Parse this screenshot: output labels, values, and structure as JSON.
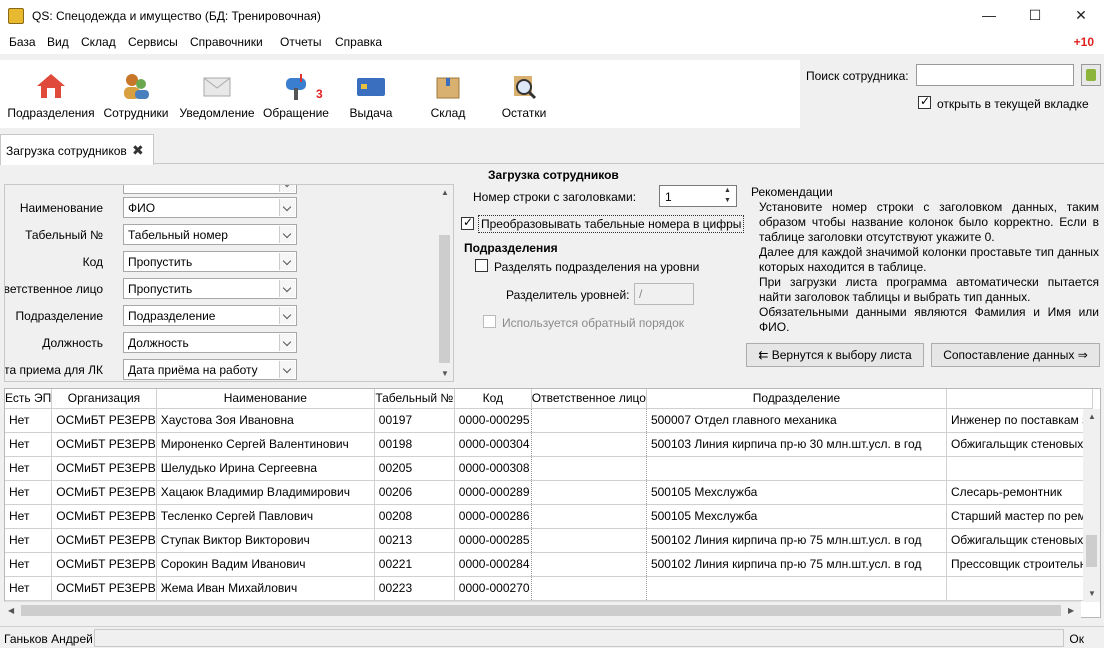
{
  "window": {
    "title": "QS: Спецодежда и имущество (БД: Тренировочная)"
  },
  "menu": {
    "items": [
      "База",
      "Вид",
      "Склад",
      "Сервисы",
      "Справочники",
      "Отчеты",
      "Справка"
    ],
    "badge": "+10"
  },
  "toolbar": {
    "buttons": [
      {
        "label": "Подразделения",
        "icon": "house-icon"
      },
      {
        "label": "Сотрудники",
        "icon": "people-icon"
      },
      {
        "label": "Уведомление",
        "icon": "envelope-icon"
      },
      {
        "label": "Обращение",
        "icon": "mailbox-icon",
        "badge": "3"
      },
      {
        "label": "Выдача",
        "icon": "card-icon"
      },
      {
        "label": "Склад",
        "icon": "box-icon"
      },
      {
        "label": "Остатки",
        "icon": "magnifier-icon"
      }
    ]
  },
  "search": {
    "label": "Поиск сотрудника:",
    "value": "",
    "open_in_tab_label": "открыть в текущей вкладке",
    "open_in_tab_checked": true
  },
  "tab": {
    "label": "Загрузка сотрудников"
  },
  "mapping": {
    "fields": [
      {
        "label": "Наименование",
        "value": "ФИО"
      },
      {
        "label": "Табельный №",
        "value": "Табельный номер"
      },
      {
        "label": "Код",
        "value": "Пропустить"
      },
      {
        "label": "Ответственное лицо",
        "value": "Пропустить"
      },
      {
        "label": "Подразделение",
        "value": "Подразделение"
      },
      {
        "label": "Должность",
        "value": "Должность"
      },
      {
        "label": "Дата приема для ЛК",
        "value": "Дата приёма на работу"
      }
    ]
  },
  "load_form": {
    "title": "Загрузка сотрудников",
    "header_row_label": "Номер строки с заголовками:",
    "header_row_value": "1",
    "convert_label": "Преобразовывать табельные номера в цифры",
    "convert_checked": true,
    "departments_title": "Подразделения",
    "split_levels_label": "Разделять подразделения на уровни",
    "split_levels_checked": false,
    "separator_label": "Разделитель уровней:",
    "separator_value": "/",
    "reverse_order_label": "Используется обратный порядок",
    "reverse_order_checked": false
  },
  "recommendations": {
    "title": "Рекомендации",
    "paragraphs": [
      "Установите номер строки с заголовком данных, таким образом чтобы название колонок было корректно. Если в таблице заголовки отсутствуют укажите 0.",
      "Далее для каждой значимой колонки проставьте тип данных которых находится в таблице.",
      "При загрузки листа программа автоматически пытается найти заголовок таблицы и выбрать тип данных.",
      "Обязательными данными являются Фамилия и Имя или ФИО."
    ]
  },
  "buttons": {
    "back": "⇇ Вернутся к выбору листа",
    "match": "Сопоставление данных ⇒"
  },
  "grid": {
    "columns": [
      "Есть ЭП",
      "Организация",
      "Наименование",
      "Табельный №",
      "Код",
      "Ответственное лицо",
      "Подразделение",
      ""
    ],
    "rows": [
      [
        "Нет",
        "ОСМиБТ РЕЗЕРВ",
        "Хаустова Зоя Ивановна",
        "00197",
        "0000-000295",
        "",
        "500007 Отдел главного механика",
        "Инженер по поставкам з"
      ],
      [
        "Нет",
        "ОСМиБТ РЕЗЕРВ",
        "Мироненко Сергей Валентинович",
        "00198",
        "0000-000304",
        "",
        "500103 Линия кирпича пр-ю 30 млн.шт.усл. в год",
        "Обжигальщик стеновых"
      ],
      [
        "Нет",
        "ОСМиБТ РЕЗЕРВ",
        "Шелудько Ирина Сергеевна",
        "00205",
        "0000-000308",
        "",
        "",
        ""
      ],
      [
        "Нет",
        "ОСМиБТ РЕЗЕРВ",
        "Хацаюк Владимир Владимирович",
        "00206",
        "0000-000289",
        "",
        "500105 Мехслужба",
        "Слесарь-ремонтник"
      ],
      [
        "Нет",
        "ОСМиБТ РЕЗЕРВ",
        "Тесленко Сергей Павлович",
        "00208",
        "0000-000286",
        "",
        "500105 Мехслужба",
        "Старший мастер по ремо"
      ],
      [
        "Нет",
        "ОСМиБТ РЕЗЕРВ",
        "Ступак Виктор Викторович",
        "00213",
        "0000-000285",
        "",
        "500102 Линия кирпича пр-ю 75 млн.шт.усл. в год",
        "Обжигальщик стеновых"
      ],
      [
        "Нет",
        "ОСМиБТ РЕЗЕРВ",
        "Сорокин Вадим Иванович",
        "00221",
        "0000-000284",
        "",
        "500102 Линия кирпича пр-ю 75 млн.шт.усл. в год",
        "Прессовщик строительн"
      ],
      [
        "Нет",
        "ОСМиБТ РЕЗЕРВ",
        "Жема Иван Михайлович",
        "00223",
        "0000-000270",
        "",
        "",
        ""
      ]
    ]
  },
  "status": {
    "user": "Ганьков Андрей",
    "state": "Ок"
  }
}
